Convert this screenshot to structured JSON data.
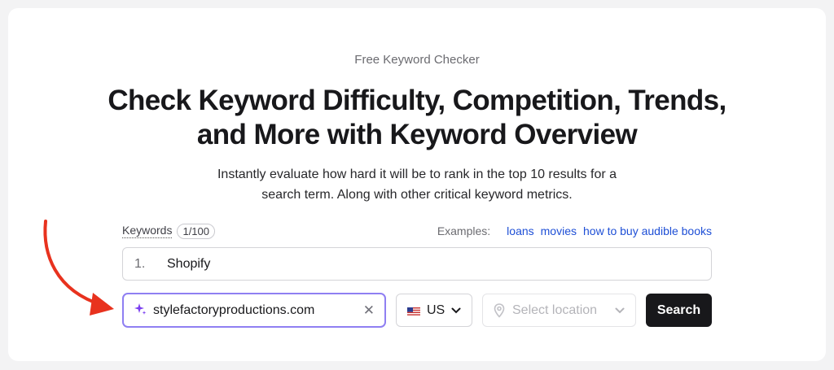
{
  "header": {
    "eyebrow": "Free Keyword Checker",
    "title_line1": "Check Keyword Difficulty, Competition, Trends,",
    "title_line2": "and More with Keyword Overview",
    "subtitle_line1": "Instantly evaluate how hard it will be to rank in the top 10 results for a",
    "subtitle_line2": "search term. Along with other critical keyword metrics."
  },
  "keywords": {
    "label": "Keywords",
    "count": "1/100",
    "examples_label": "Examples:",
    "examples": [
      "loans",
      "movies",
      "how to buy audible books"
    ],
    "rows": [
      {
        "num": "1.",
        "text": "Shopify"
      }
    ]
  },
  "domain": {
    "value": "stylefactoryproductions.com",
    "icon": "sparkle-icon"
  },
  "country": {
    "value": "US",
    "flag": "us-flag-icon"
  },
  "location": {
    "placeholder": "Select location"
  },
  "search": {
    "label": "Search"
  },
  "colors": {
    "accent_border": "#8f7ff2",
    "sparkle": "#7b3ff0",
    "link": "#1e4fd6",
    "button": "#18181b",
    "arrow": "#e8321e"
  }
}
